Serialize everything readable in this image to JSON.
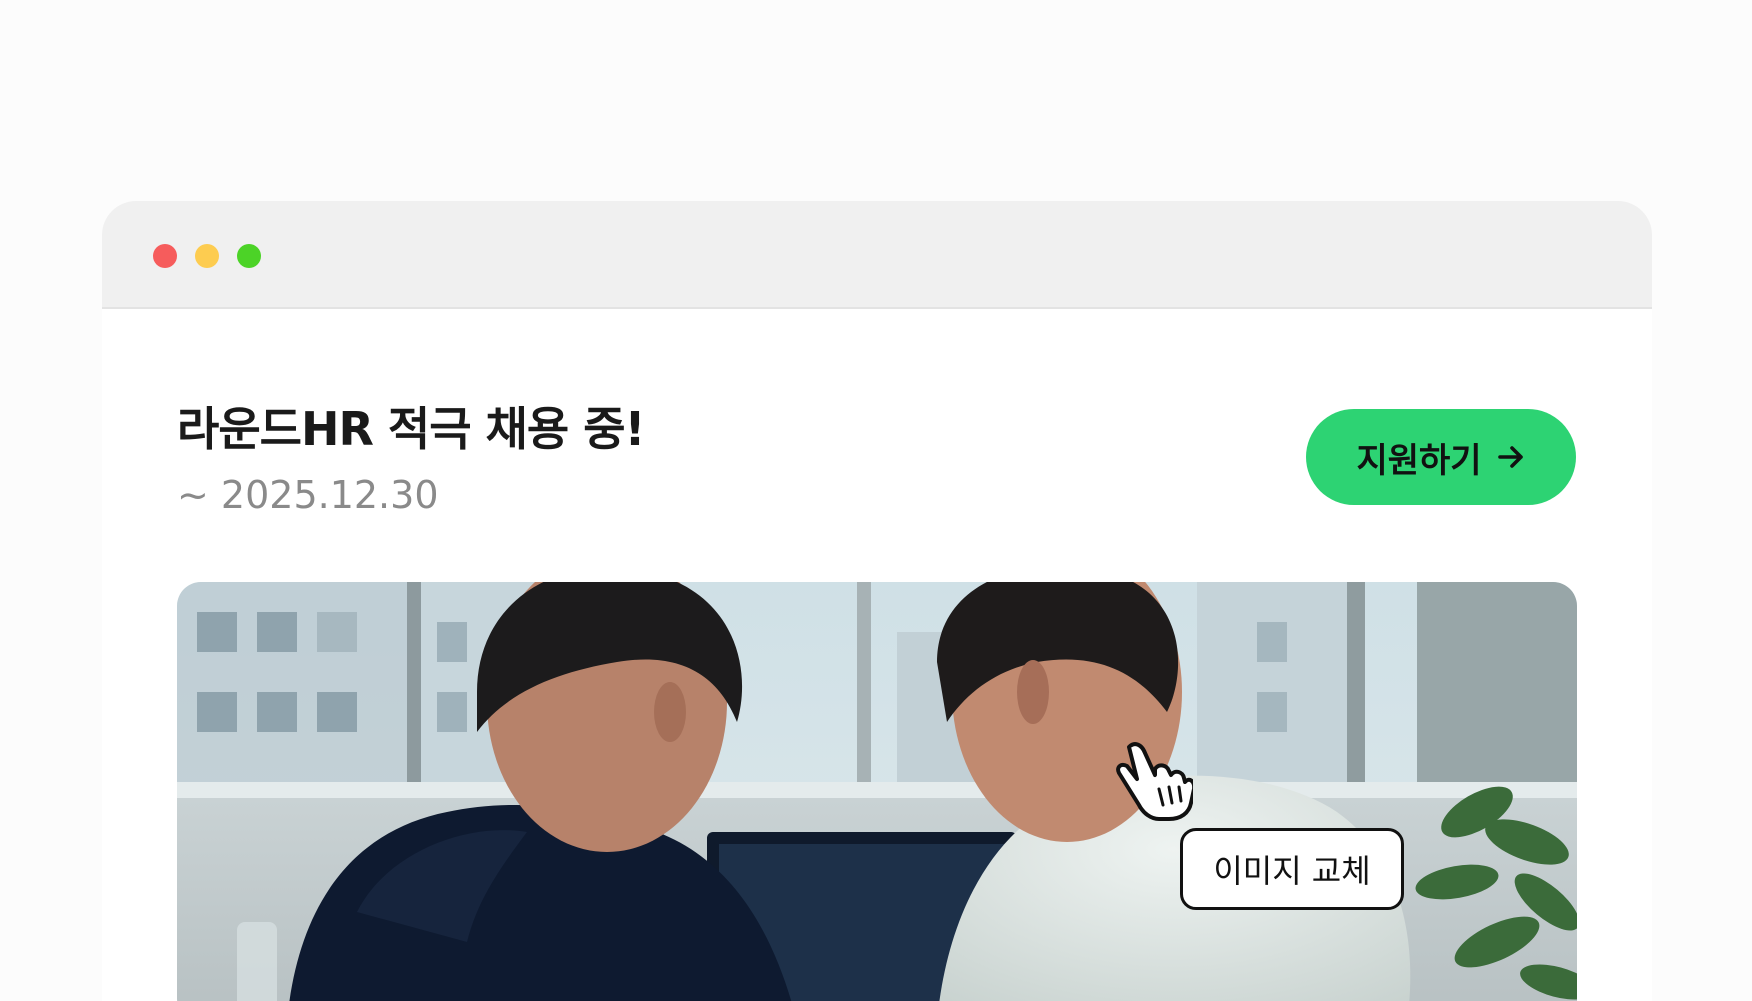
{
  "colors": {
    "accent": "#2dd373",
    "dot_red": "#f65c5c",
    "dot_yellow": "#fdcc50",
    "dot_green": "#4cd327"
  },
  "job": {
    "title": "라운드HR 적극 채용 중!",
    "deadline": "~ 2025.12.30"
  },
  "actions": {
    "apply_label": "지원하기",
    "apply_icon": "arrow-right-icon",
    "replace_image_label": "이미지 교체",
    "cursor_icon": "hand-pointer-icon"
  },
  "photo": {
    "subject": "two people looking at a laptop near a window"
  }
}
